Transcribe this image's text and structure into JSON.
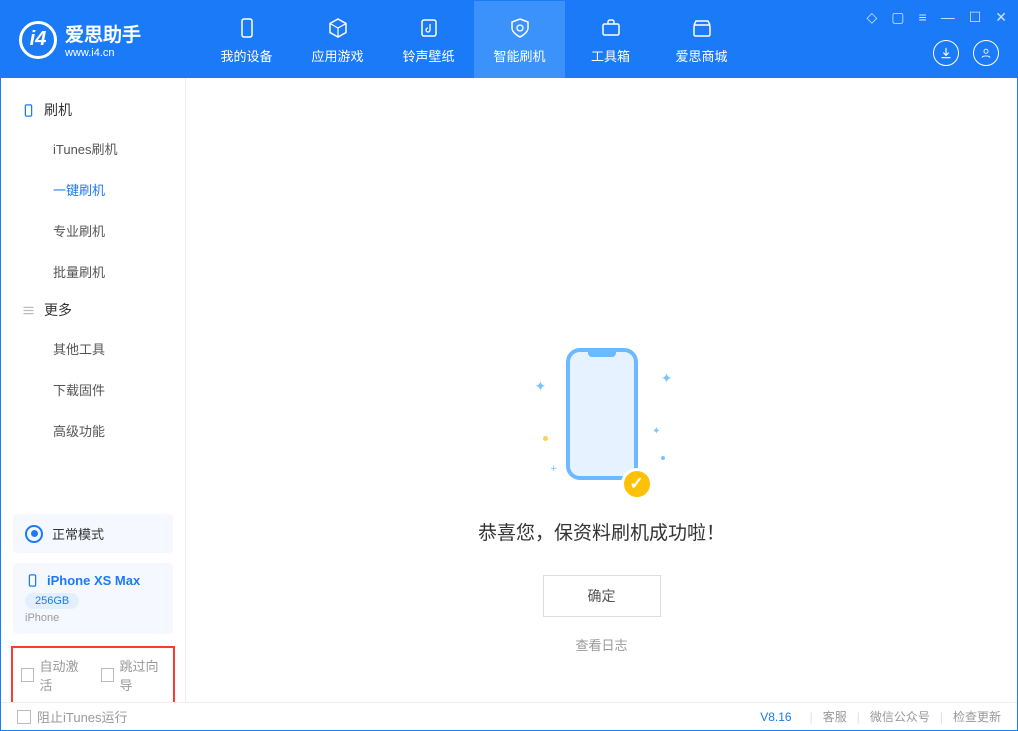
{
  "brand": {
    "name": "爱思助手",
    "url": "www.i4.cn"
  },
  "nav": {
    "device": "我的设备",
    "apps": "应用游戏",
    "ringtones": "铃声壁纸",
    "flash": "智能刷机",
    "toolbox": "工具箱",
    "store": "爱思商城"
  },
  "sidebar": {
    "group1_title": "刷机",
    "items1": {
      "itunes": "iTunes刷机",
      "oneclick": "一键刷机",
      "pro": "专业刷机",
      "batch": "批量刷机"
    },
    "group2_title": "更多",
    "items2": {
      "other": "其他工具",
      "firmware": "下载固件",
      "advanced": "高级功能"
    },
    "mode_label": "正常模式",
    "device_name": "iPhone XS Max",
    "device_capacity": "256GB",
    "device_type": "iPhone",
    "auto_activate": "自动激活",
    "skip_guide": "跳过向导"
  },
  "content": {
    "success_message": "恭喜您，保资料刷机成功啦！",
    "ok_button": "确定",
    "view_log": "查看日志"
  },
  "footer": {
    "stop_itunes": "阻止iTunes运行",
    "version": "V8.16",
    "service": "客服",
    "wechat": "微信公众号",
    "check_update": "检查更新"
  }
}
